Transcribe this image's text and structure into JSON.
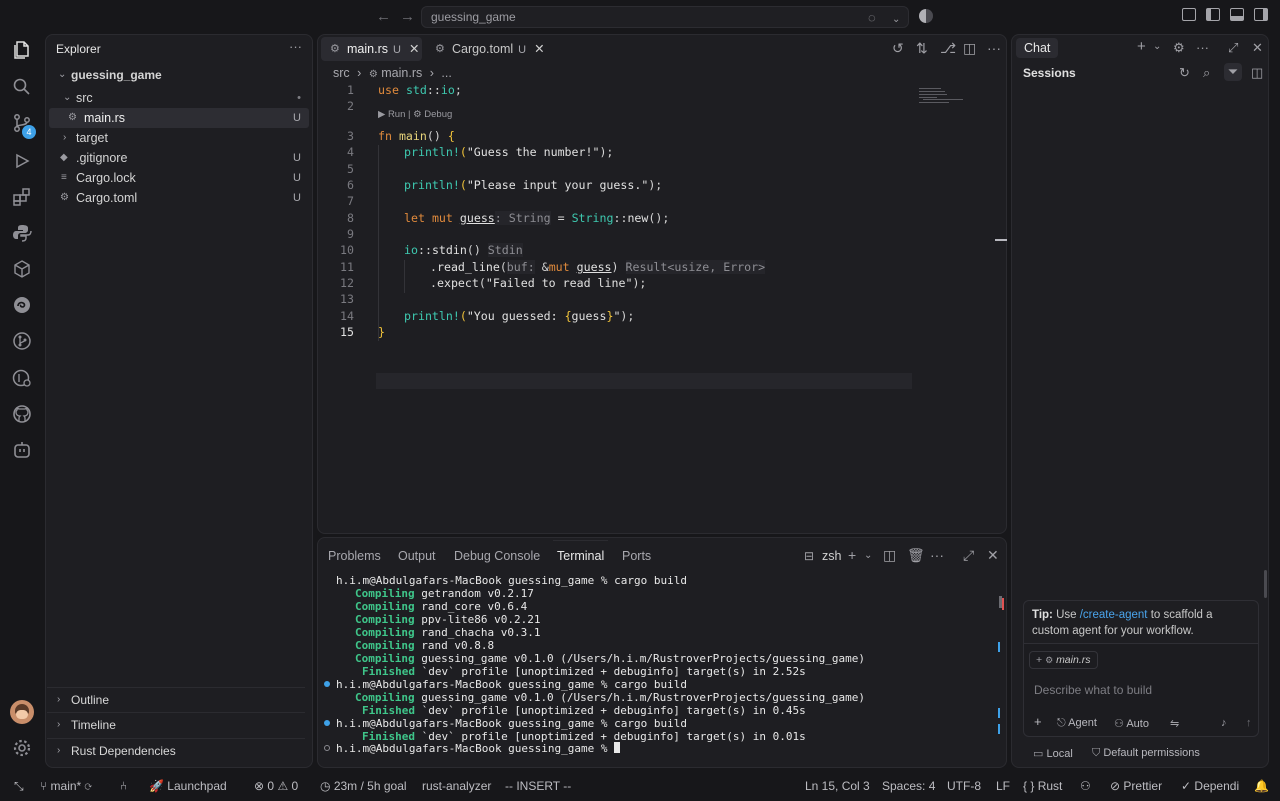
{
  "titlebar": {
    "search": "guessing_game"
  },
  "activity": {
    "scm_badge": "4"
  },
  "explorer": {
    "title": "Explorer",
    "root": "guessing_game",
    "items": [
      {
        "label": "src",
        "status": "•"
      },
      {
        "label": "main.rs",
        "status": "U"
      },
      {
        "label": "target",
        "status": ""
      },
      {
        "label": ".gitignore",
        "status": "U"
      },
      {
        "label": "Cargo.lock",
        "status": "U"
      },
      {
        "label": "Cargo.toml",
        "status": "U"
      }
    ],
    "sections": [
      "Outline",
      "Timeline",
      "Rust Dependencies"
    ]
  },
  "editor": {
    "tabs": [
      {
        "label": "main.rs",
        "status": "U"
      },
      {
        "label": "Cargo.toml",
        "status": "U"
      }
    ],
    "breadcrumb": {
      "folder": "src",
      "file": "main.rs",
      "more": "..."
    },
    "codelens": "▶ Run | ⚙ Debug",
    "line_numbers": [
      "1",
      "2",
      "3",
      "4",
      "5",
      "6",
      "7",
      "8",
      "9",
      "10",
      "11",
      "12",
      "13",
      "14",
      "15"
    ],
    "code": {
      "l1": {
        "kw": "use",
        "ns": "std",
        "sep": "::",
        "id": "io",
        "end": ";"
      },
      "l3": {
        "kw": "fn",
        "name": "main",
        "parens": "()",
        "brace": "{"
      },
      "l4": {
        "mac": "println!",
        "open": "(",
        "str": "\"Guess the number!\"",
        "close": ");"
      },
      "l6": {
        "mac": "println!",
        "open": "(",
        "str": "\"Please input your guess.\"",
        "close": ");"
      },
      "l8": {
        "kw1": "let",
        "kw2": "mut",
        "var": "guess",
        "hint": ": String",
        "eq": " = ",
        "ty": "String",
        "sep": "::",
        "fn": "new",
        "end": "();"
      },
      "l10": {
        "ns": "io",
        "sep": "::",
        "fn": "stdin",
        "parens": "()",
        "hint": "Stdin"
      },
      "l11": {
        "dot": ".",
        "fn": "read_line",
        "open": "(",
        "hint1": "buf:",
        "amp": " &",
        "kw": "mut",
        "var": "guess",
        "close": ")",
        "hint2": "Result<usize, Error>"
      },
      "l12": {
        "dot": ".",
        "fn": "expect",
        "open": "(",
        "str": "\"Failed to read line\"",
        "close": ");"
      },
      "l14": {
        "mac": "println!",
        "open": "(",
        "str1": "\"You guessed: ",
        "b1": "{",
        "var": "guess",
        "b2": "}",
        "str2": "\"",
        "close": ");"
      },
      "l15": {
        "brace": "}"
      }
    }
  },
  "terminal": {
    "tabs": [
      "Problems",
      "Output",
      "Debug Console",
      "Terminal",
      "Ports"
    ],
    "shell": "zsh",
    "lines": [
      {
        "kw": "",
        "text": "h.i.m@Abdulgafars-MacBook guessing_game % cargo build"
      },
      {
        "kw": "Compiling",
        "text": " getrandom v0.2.17"
      },
      {
        "kw": "Compiling",
        "text": " rand_core v0.6.4"
      },
      {
        "kw": "Compiling",
        "text": " ppv-lite86 v0.2.21"
      },
      {
        "kw": "Compiling",
        "text": " rand_chacha v0.3.1"
      },
      {
        "kw": "Compiling",
        "text": " rand v0.8.8"
      },
      {
        "kw": "Compiling",
        "text": " guessing_game v0.1.0 (/Users/h.i.m/RustroverProjects/guessing_game)"
      },
      {
        "kw": "Finished",
        "text": " `dev` profile [unoptimized + debuginfo] target(s) in 2.52s"
      },
      {
        "kw": "",
        "text": "h.i.m@Abdulgafars-MacBook guessing_game % cargo build"
      },
      {
        "kw": "Compiling",
        "text": " guessing_game v0.1.0 (/Users/h.i.m/RustroverProjects/guessing_game)"
      },
      {
        "kw": "Finished",
        "text": " `dev` profile [unoptimized + debuginfo] target(s) in 0.45s"
      },
      {
        "kw": "",
        "text": "h.i.m@Abdulgafars-MacBook guessing_game % cargo build"
      },
      {
        "kw": "Finished",
        "text": " `dev` profile [unoptimized + debuginfo] target(s) in 0.01s"
      },
      {
        "kw": "",
        "text": "h.i.m@Abdulgafars-MacBook guessing_game % "
      }
    ]
  },
  "chat": {
    "title": "Chat",
    "sessions": "Sessions",
    "tip_label": "Tip:",
    "tip_pre": "Use",
    "tip_link": "/create-agent",
    "tip_post": "to scaffold a custom agent for your workflow.",
    "chip": "main.rs",
    "placeholder": "Describe what to build",
    "mode": "Agent",
    "model": "Auto",
    "footer_left": "Local",
    "footer_right": "Default permissions"
  },
  "statusbar": {
    "branch": "main*",
    "launchpad": "Launchpad",
    "errors": "0",
    "warnings": "0",
    "timer": "23m / 5h goal",
    "analyzer": "rust-analyzer",
    "mode": "-- INSERT --",
    "position": "Ln 15, Col 3",
    "spaces": "Spaces: 4",
    "encoding": "UTF-8",
    "eol": "LF",
    "language": "Rust",
    "prettier": "Prettier",
    "deps": "Dependi"
  },
  "colors": {
    "accent": "#3ea1e8",
    "compiling": "#3fc68a",
    "keyword": "#e08a3c",
    "type": "#3ec9b0",
    "string": "#f1c33a"
  }
}
